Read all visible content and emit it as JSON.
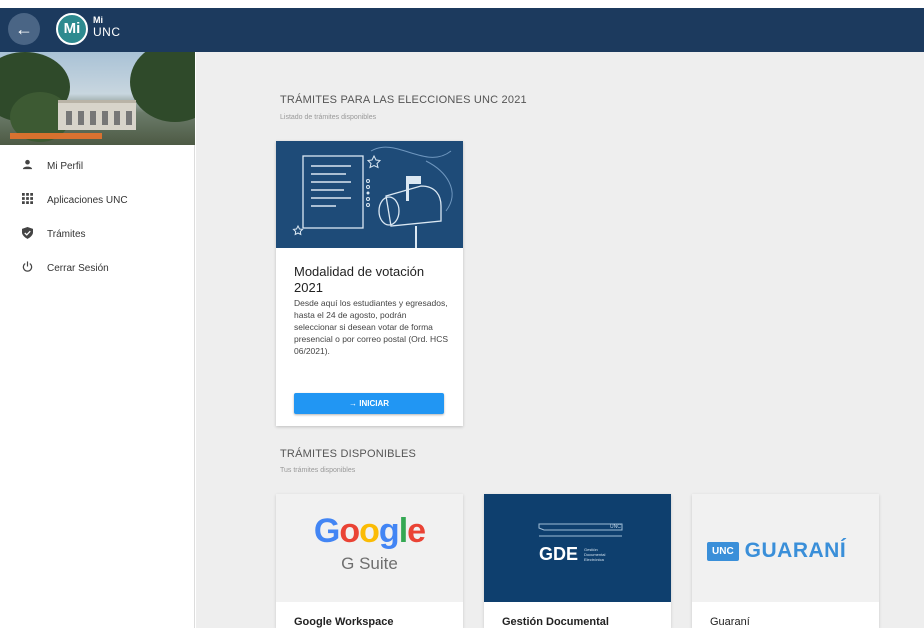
{
  "header": {
    "back_icon": "arrow-left-icon",
    "logo_circle": "Mi",
    "logo_mi": "Mi",
    "logo_unc": "UNC"
  },
  "sidebar": {
    "items": [
      {
        "icon": "person-icon",
        "label": "Mi Perfil"
      },
      {
        "icon": "grid-icon",
        "label": "Aplicaciones UNC"
      },
      {
        "icon": "shield-check-icon",
        "label": "Trámites"
      },
      {
        "icon": "power-icon",
        "label": "Cerrar Sesión"
      }
    ]
  },
  "elections": {
    "title": "TRÁMITES PARA LAS ELECCIONES UNC 2021",
    "subtitle": "Listado de trámites disponibles",
    "card": {
      "title": "Modalidad de votación 2021",
      "description": "Desde aquí los estudiantes y egresados, hasta el 24 de agosto, podrán seleccionar si desean votar de forma presencial o por correo postal (Ord. HCS 06/2021).",
      "button_label": "→  INICIAR"
    }
  },
  "available": {
    "title": "TRÁMITES DISPONIBLES",
    "subtitle": "Tus trámites disponibles",
    "apps": [
      {
        "name": "Google Workspace",
        "logo_main": "Google",
        "logo_sub": "G Suite"
      },
      {
        "name": "Gestión Documental",
        "logo_main": "GDE",
        "logo_sub": "Gestión Documental Electrónica",
        "logo_tag": "UNC"
      },
      {
        "name": "Guaraní",
        "logo_badge": "UNC",
        "logo_main": "GUARANÍ"
      }
    ]
  },
  "colors": {
    "topbar": "#1c3a5e",
    "primary_button": "#2196f3",
    "gde_blue": "#0e3f6e",
    "guarani_blue": "#3a8fd9"
  }
}
